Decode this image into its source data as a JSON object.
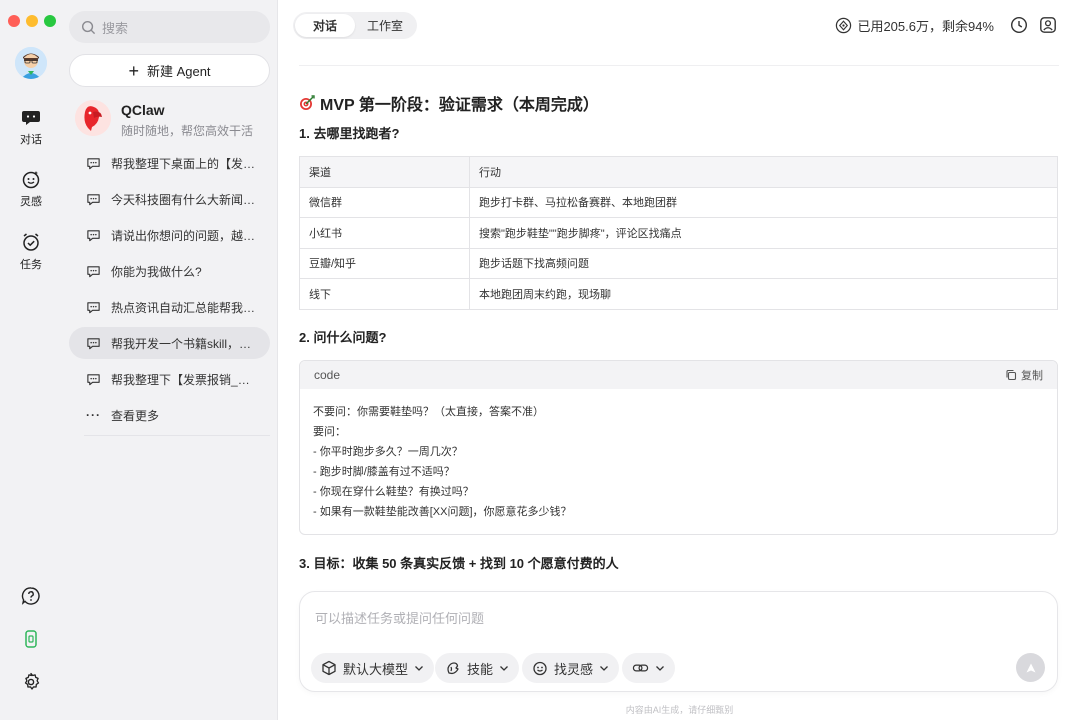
{
  "rail": {
    "items": [
      {
        "label": "对话"
      },
      {
        "label": "灵感"
      },
      {
        "label": "任务"
      }
    ]
  },
  "sidebar": {
    "search_placeholder": "搜索",
    "new_agent": "新建 Agent",
    "agent": {
      "name": "QClaw",
      "subtitle": "随时随地，帮您高效干活"
    },
    "conversations": [
      {
        "title": "帮我整理下桌面上的【发票报销】"
      },
      {
        "title": "今天科技圈有什么大新闻，帮我汇总"
      },
      {
        "title": "请说出你想问的问题，越具体越好"
      },
      {
        "title": "你能为我做什么?"
      },
      {
        "title": "热点资讯自动汇总能帮我做什么"
      },
      {
        "title": "帮我开发一个书籍skill，能够推荐"
      },
      {
        "title": "帮我整理下【发票报销_副本】"
      }
    ],
    "more": "查看更多"
  },
  "header": {
    "tabs": [
      {
        "label": "对话"
      },
      {
        "label": "工作室"
      }
    ],
    "usage": "已用205.6万，剩余94%"
  },
  "content": {
    "heading": "MVP 第一阶段：验证需求（本周完成）",
    "section1": "1. 去哪里找跑者?",
    "table": {
      "headers": [
        "渠道",
        "行动"
      ],
      "rows": [
        [
          "微信群",
          "跑步打卡群、马拉松备赛群、本地跑团群"
        ],
        [
          "小红书",
          "搜索\"跑步鞋垫\"\"跑步脚疼\"，评论区找痛点"
        ],
        [
          "豆瓣/知乎",
          "跑步话题下找高频问题"
        ],
        [
          "线下",
          "本地跑团周末约跑，现场聊"
        ]
      ]
    },
    "section2": "2. 问什么问题?",
    "code": {
      "lang": "code",
      "copy": "复制",
      "lines": [
        "不要问：你需要鞋垫吗？（太直接，答案不准）",
        "要问：",
        "-  你平时跑步多久？一周几次？",
        "-  跑步时脚/膝盖有过不适吗？",
        "-  你现在穿什么鞋垫？有换过吗？",
        "-  如果有一款鞋垫能改善[XX问题]，你愿意花多少钱？"
      ]
    },
    "section3": "3. 目标：收集 50 条真实反馈 + 找到 10 个愿意付费的人"
  },
  "composer": {
    "placeholder": "可以描述任务或提问任何问题",
    "model": "默认大模型",
    "skills": "技能",
    "inspiration": "找灵感",
    "footer": "内容由AI生成，请仔细甄别"
  },
  "colors": {
    "accent": "#2fb65b",
    "active_item": "#e4e4e8"
  }
}
